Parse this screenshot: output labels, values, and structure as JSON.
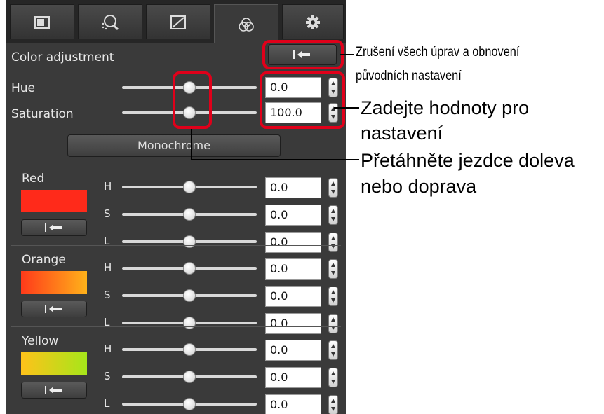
{
  "panel": {
    "tabs": [
      {
        "name": "basic-image-adjustment",
        "icon": "rectangle-icon"
      },
      {
        "name": "detail-adjustment",
        "icon": "magnifier-icon"
      },
      {
        "name": "tone-curve",
        "icon": "curve-icon"
      },
      {
        "name": "color-adjustment",
        "icon": "color-circles-icon",
        "active": true
      },
      {
        "name": "settings",
        "icon": "gear-icon"
      }
    ],
    "section_title": "Color adjustment",
    "hue": {
      "label": "Hue",
      "value": "0.0",
      "level": 0.5
    },
    "saturation": {
      "label": "Saturation",
      "value": "100.0",
      "level": 0.5
    },
    "monochrome_label": "Monochrome",
    "groups": [
      {
        "name": "Red",
        "swatch": "#ff2a1a",
        "rows": [
          {
            "label": "H",
            "value": "0.0",
            "level": 0.5
          },
          {
            "label": "S",
            "value": "0.0",
            "level": 0.5
          },
          {
            "label": "L",
            "value": "0.0",
            "level": 0.5
          }
        ]
      },
      {
        "name": "Orange",
        "swatch_from": "#ff3a1a",
        "swatch_to": "#ffb21a",
        "rows": [
          {
            "label": "H",
            "value": "0.0",
            "level": 0.5
          },
          {
            "label": "S",
            "value": "0.0",
            "level": 0.5
          },
          {
            "label": "L",
            "value": "0.0",
            "level": 0.5
          }
        ]
      },
      {
        "name": "Yellow",
        "swatch_from": "#ffc21a",
        "swatch_to": "#a6e61a",
        "rows": [
          {
            "label": "H",
            "value": "0.0",
            "level": 0.5
          },
          {
            "label": "S",
            "value": "0.0",
            "level": 0.5
          },
          {
            "label": "L",
            "value": "0.0",
            "level": 0.5
          }
        ]
      }
    ]
  },
  "callouts": {
    "reset": [
      "Zrušení všech úprav a obnovení",
      "původních nastavení"
    ],
    "values": [
      "Zadejte hodnoty pro",
      "nastavení"
    ],
    "sliders": [
      "Přetáhněte jezdce doleva",
      "nebo doprava"
    ]
  },
  "colors": {
    "highlight": "#e0001a",
    "panel": "#3a3a3a"
  }
}
